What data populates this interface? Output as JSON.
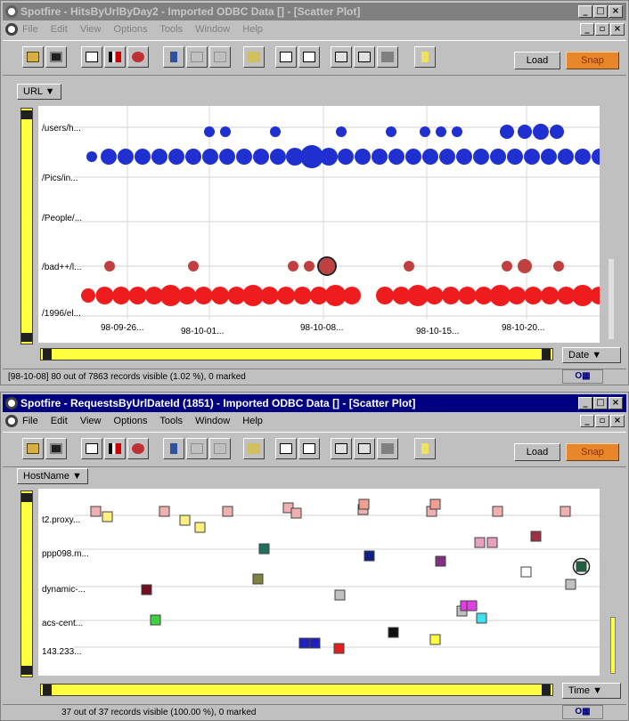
{
  "window1": {
    "title": "Spotfire - HitsByUrlByDay2 - Imported ODBC Data [] - [Scatter Plot]",
    "menu": [
      "File",
      "Edit",
      "View",
      "Options",
      "Tools",
      "Window",
      "Help"
    ],
    "load_label": "Load",
    "snap_label": "Snap",
    "y_axis_column": "URL ▼",
    "x_axis_column": "Date ▼",
    "y_labels": [
      "/users/h...",
      "/Pics/in...",
      "/People/...",
      "/bad++/l...",
      "/1996/el..."
    ],
    "x_labels": [
      "98-09-26...",
      "98-10-01...",
      "98-10-08...",
      "98-10-15...",
      "98-10-20..."
    ],
    "status": "[98-10-08] 80 out of 7863 records visible (1.02 %), 0 marked",
    "colors": {
      "blue": "#1f2fd0",
      "red": "#ee1c1c",
      "brown": "#c04040"
    }
  },
  "window2": {
    "title": "Spotfire - RequestsByUrlDateId (1851) - Imported ODBC Data [] - [Scatter Plot]",
    "menu": [
      "File",
      "Edit",
      "View",
      "Options",
      "Tools",
      "Window",
      "Help"
    ],
    "load_label": "Load",
    "snap_label": "Snap",
    "y_axis_column": "HostName ▼",
    "x_axis_column": "Time ▼",
    "y_labels": [
      "t2.proxy...",
      "ppp098.m...",
      "dynamic-...",
      "acs-cent...",
      "143.233..."
    ],
    "status": "37 out of 37 records visible (100.00 %), 0 marked"
  },
  "logo_text": "O"
}
